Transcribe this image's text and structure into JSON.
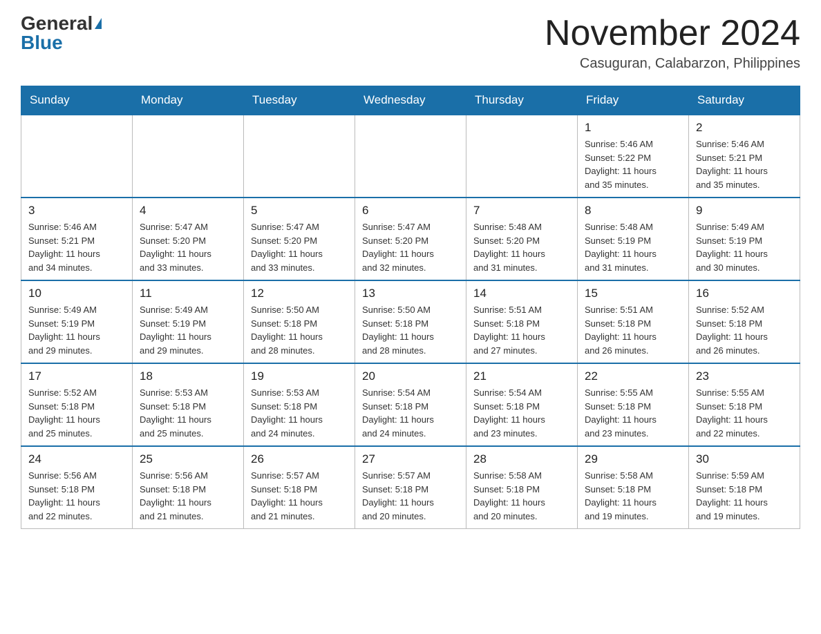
{
  "header": {
    "logo_general": "General",
    "logo_blue": "Blue",
    "month_title": "November 2024",
    "location": "Casuguran, Calabarzon, Philippines"
  },
  "weekdays": [
    "Sunday",
    "Monday",
    "Tuesday",
    "Wednesday",
    "Thursday",
    "Friday",
    "Saturday"
  ],
  "weeks": [
    [
      {
        "day": "",
        "info": ""
      },
      {
        "day": "",
        "info": ""
      },
      {
        "day": "",
        "info": ""
      },
      {
        "day": "",
        "info": ""
      },
      {
        "day": "",
        "info": ""
      },
      {
        "day": "1",
        "info": "Sunrise: 5:46 AM\nSunset: 5:22 PM\nDaylight: 11 hours\nand 35 minutes."
      },
      {
        "day": "2",
        "info": "Sunrise: 5:46 AM\nSunset: 5:21 PM\nDaylight: 11 hours\nand 35 minutes."
      }
    ],
    [
      {
        "day": "3",
        "info": "Sunrise: 5:46 AM\nSunset: 5:21 PM\nDaylight: 11 hours\nand 34 minutes."
      },
      {
        "day": "4",
        "info": "Sunrise: 5:47 AM\nSunset: 5:20 PM\nDaylight: 11 hours\nand 33 minutes."
      },
      {
        "day": "5",
        "info": "Sunrise: 5:47 AM\nSunset: 5:20 PM\nDaylight: 11 hours\nand 33 minutes."
      },
      {
        "day": "6",
        "info": "Sunrise: 5:47 AM\nSunset: 5:20 PM\nDaylight: 11 hours\nand 32 minutes."
      },
      {
        "day": "7",
        "info": "Sunrise: 5:48 AM\nSunset: 5:20 PM\nDaylight: 11 hours\nand 31 minutes."
      },
      {
        "day": "8",
        "info": "Sunrise: 5:48 AM\nSunset: 5:19 PM\nDaylight: 11 hours\nand 31 minutes."
      },
      {
        "day": "9",
        "info": "Sunrise: 5:49 AM\nSunset: 5:19 PM\nDaylight: 11 hours\nand 30 minutes."
      }
    ],
    [
      {
        "day": "10",
        "info": "Sunrise: 5:49 AM\nSunset: 5:19 PM\nDaylight: 11 hours\nand 29 minutes."
      },
      {
        "day": "11",
        "info": "Sunrise: 5:49 AM\nSunset: 5:19 PM\nDaylight: 11 hours\nand 29 minutes."
      },
      {
        "day": "12",
        "info": "Sunrise: 5:50 AM\nSunset: 5:18 PM\nDaylight: 11 hours\nand 28 minutes."
      },
      {
        "day": "13",
        "info": "Sunrise: 5:50 AM\nSunset: 5:18 PM\nDaylight: 11 hours\nand 28 minutes."
      },
      {
        "day": "14",
        "info": "Sunrise: 5:51 AM\nSunset: 5:18 PM\nDaylight: 11 hours\nand 27 minutes."
      },
      {
        "day": "15",
        "info": "Sunrise: 5:51 AM\nSunset: 5:18 PM\nDaylight: 11 hours\nand 26 minutes."
      },
      {
        "day": "16",
        "info": "Sunrise: 5:52 AM\nSunset: 5:18 PM\nDaylight: 11 hours\nand 26 minutes."
      }
    ],
    [
      {
        "day": "17",
        "info": "Sunrise: 5:52 AM\nSunset: 5:18 PM\nDaylight: 11 hours\nand 25 minutes."
      },
      {
        "day": "18",
        "info": "Sunrise: 5:53 AM\nSunset: 5:18 PM\nDaylight: 11 hours\nand 25 minutes."
      },
      {
        "day": "19",
        "info": "Sunrise: 5:53 AM\nSunset: 5:18 PM\nDaylight: 11 hours\nand 24 minutes."
      },
      {
        "day": "20",
        "info": "Sunrise: 5:54 AM\nSunset: 5:18 PM\nDaylight: 11 hours\nand 24 minutes."
      },
      {
        "day": "21",
        "info": "Sunrise: 5:54 AM\nSunset: 5:18 PM\nDaylight: 11 hours\nand 23 minutes."
      },
      {
        "day": "22",
        "info": "Sunrise: 5:55 AM\nSunset: 5:18 PM\nDaylight: 11 hours\nand 23 minutes."
      },
      {
        "day": "23",
        "info": "Sunrise: 5:55 AM\nSunset: 5:18 PM\nDaylight: 11 hours\nand 22 minutes."
      }
    ],
    [
      {
        "day": "24",
        "info": "Sunrise: 5:56 AM\nSunset: 5:18 PM\nDaylight: 11 hours\nand 22 minutes."
      },
      {
        "day": "25",
        "info": "Sunrise: 5:56 AM\nSunset: 5:18 PM\nDaylight: 11 hours\nand 21 minutes."
      },
      {
        "day": "26",
        "info": "Sunrise: 5:57 AM\nSunset: 5:18 PM\nDaylight: 11 hours\nand 21 minutes."
      },
      {
        "day": "27",
        "info": "Sunrise: 5:57 AM\nSunset: 5:18 PM\nDaylight: 11 hours\nand 20 minutes."
      },
      {
        "day": "28",
        "info": "Sunrise: 5:58 AM\nSunset: 5:18 PM\nDaylight: 11 hours\nand 20 minutes."
      },
      {
        "day": "29",
        "info": "Sunrise: 5:58 AM\nSunset: 5:18 PM\nDaylight: 11 hours\nand 19 minutes."
      },
      {
        "day": "30",
        "info": "Sunrise: 5:59 AM\nSunset: 5:18 PM\nDaylight: 11 hours\nand 19 minutes."
      }
    ]
  ]
}
